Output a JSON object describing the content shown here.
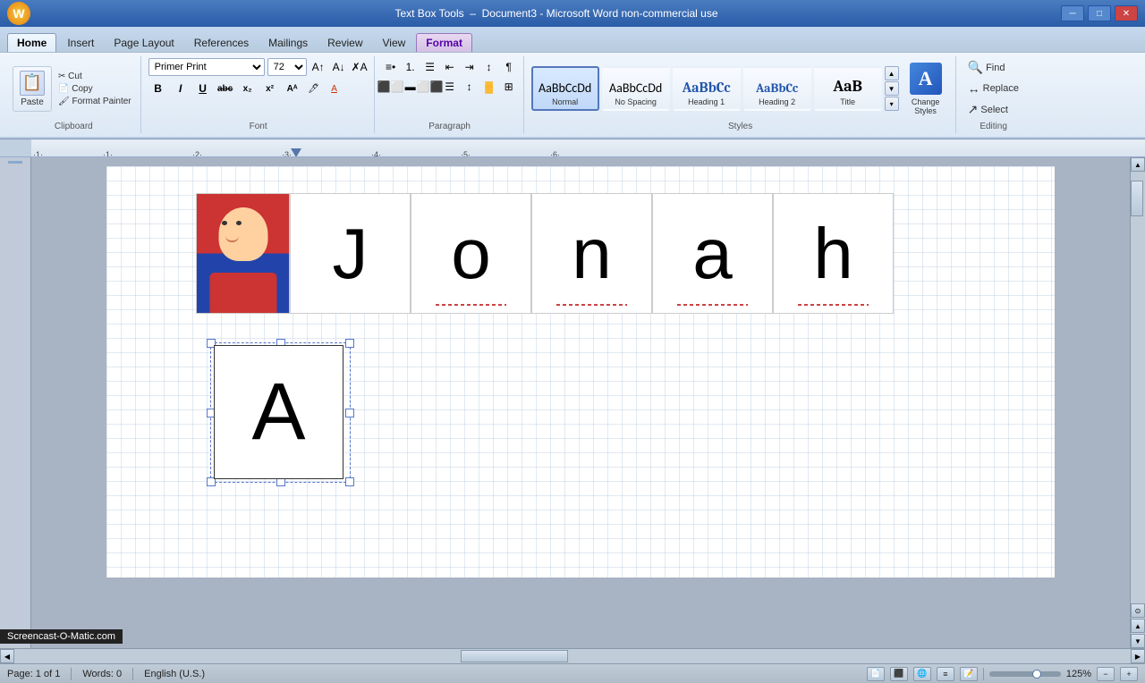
{
  "titlebar": {
    "app_name": "Text Box Tools",
    "doc_title": "Document3 - Microsoft Word non-commercial use",
    "minimize": "─",
    "maximize": "□",
    "close": "✕"
  },
  "ribbon": {
    "tabs": [
      {
        "label": "Home",
        "active": true
      },
      {
        "label": "Insert",
        "active": false
      },
      {
        "label": "Page Layout",
        "active": false
      },
      {
        "label": "References",
        "active": false
      },
      {
        "label": "Mailings",
        "active": false
      },
      {
        "label": "Review",
        "active": false
      },
      {
        "label": "View",
        "active": false
      },
      {
        "label": "Format",
        "active": false,
        "special": true
      }
    ],
    "clipboard": {
      "paste": "Paste",
      "cut": "Cut",
      "copy": "Copy",
      "format_painter": "Format Painter",
      "label": "Clipboard"
    },
    "font": {
      "name": "Primer Print",
      "size": "72",
      "label": "Font",
      "bold": "B",
      "italic": "I",
      "underline": "U",
      "strikethrough": "abc",
      "superscript": "x²",
      "subscript": "x₂"
    },
    "paragraph": {
      "label": "Paragraph"
    },
    "styles": {
      "label": "Styles",
      "items": [
        {
          "label": "Normal",
          "active": true,
          "sample": "AaBbCcDd"
        },
        {
          "label": "No Spacing",
          "active": false,
          "sample": "AaBbCcDd"
        },
        {
          "label": "Heading 1",
          "active": false,
          "sample": "AaBbCc"
        },
        {
          "label": "Heading 2",
          "active": false,
          "sample": "AaBbCc"
        },
        {
          "label": "Title",
          "active": false,
          "sample": "AaB"
        }
      ],
      "change_styles": "Change Styles"
    },
    "editing": {
      "label": "Editing",
      "find": "Find",
      "replace": "Replace",
      "select": "Select"
    }
  },
  "document": {
    "letters": [
      "J",
      "o",
      "n",
      "a",
      "h"
    ],
    "text_box_letter": "A",
    "zoom": "125%"
  },
  "statusbar": {
    "page": "Page: 1 of 1",
    "words": "Words: 0",
    "language": "English (U.S.)",
    "zoom": "125%"
  },
  "watermark": {
    "text": "Screencast-O-Matic.com"
  }
}
